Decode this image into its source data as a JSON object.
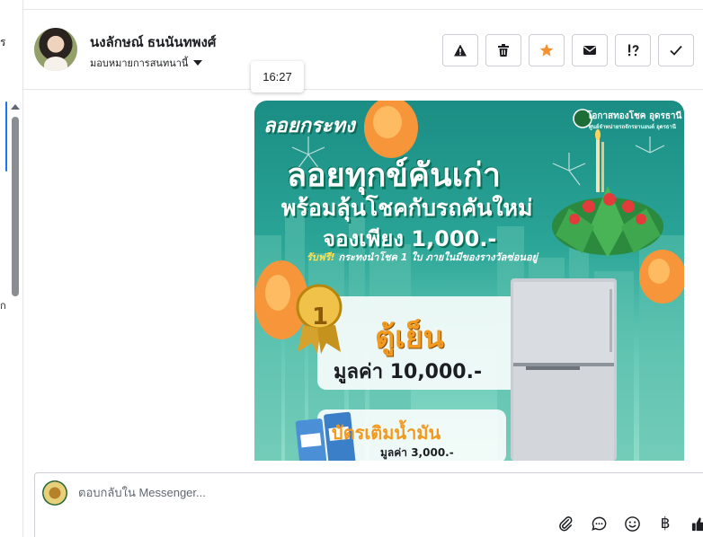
{
  "sidebar_fragments": {
    "top": "ร",
    "mid": "ก"
  },
  "header": {
    "contact_name": "นงลักษณ์ ธนนันทพงศ์",
    "assign_label": "มอบหมายการสนทนานี้"
  },
  "actions": [
    {
      "name": "spam",
      "icon": "warning-icon"
    },
    {
      "name": "delete",
      "icon": "trash-icon"
    },
    {
      "name": "star",
      "icon": "star-icon",
      "color": "#f5922f"
    },
    {
      "name": "mark-unread",
      "icon": "envelope-icon"
    },
    {
      "name": "follow-up",
      "icon": "follow-up-icon"
    },
    {
      "name": "done",
      "icon": "check-icon"
    }
  ],
  "timestamp": "16:27",
  "promo_image": {
    "brand": "ลอยกระทง",
    "org_name": "โอกาสทองโชค อุดรธานี",
    "org_sub": "ศูนย์จำหน่ายรถจักรยานยนต์ อุดรธานี",
    "headline_1": "ลอยทุกข์คันเก่า",
    "headline_2": "พร้อมลุ้นโชคกับรถคันใหม่",
    "headline_3": "จองเพียง 1,000.-",
    "free_label": "รับฟรี!",
    "free_text": "กระทงนำโชค 1 ใบ ภายในมีของรางวัลซ่อนอยู่",
    "badge": "1",
    "prize_1": "ตู้เย็น",
    "prize_1_value": "มูลค่า 10,000.-",
    "prize_2": "บัตรเติมน้ำมัน",
    "prize_2_value": "มูลค่า 3,000.-"
  },
  "composer": {
    "placeholder": "ตอบกลับใน Messenger...",
    "value": ""
  },
  "colors": {
    "accent": "#1877f2",
    "star": "#f5922f"
  }
}
